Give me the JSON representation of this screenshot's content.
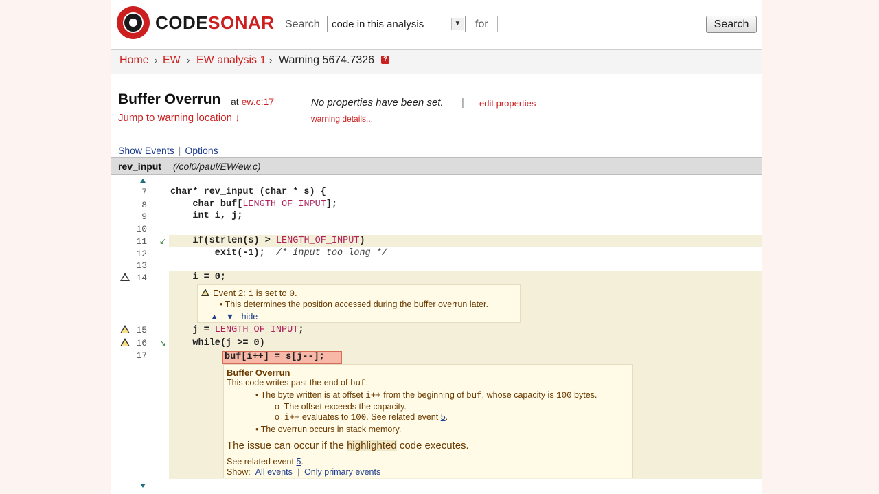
{
  "header": {
    "brand_part1": "CODE",
    "brand_part2": "SONAR",
    "search_label": "Search",
    "search_scope": "code in this analysis",
    "for_label": "for",
    "query_value": "",
    "search_button": "Search"
  },
  "breadcrumb": {
    "items": [
      "Home",
      "EW",
      "EW analysis 1",
      "Warning 5674.7326"
    ],
    "separator": "›",
    "help_icon": "?"
  },
  "warning": {
    "title": "Buffer Overrun",
    "at_label": "at",
    "location": "ew.c:17",
    "jump_link": "Jump to warning location ↓",
    "no_props": "No properties have been set.",
    "pipe": "|",
    "edit_props": "edit properties",
    "details": "warning details..."
  },
  "tabs": {
    "show_events": "Show Events",
    "options": "Options",
    "pipe": "|"
  },
  "file": {
    "function": "rev_input",
    "path": "(/col0/paul/EW/ew.c)"
  },
  "code": {
    "line_numbers": [
      "7",
      "8",
      "9",
      "10",
      "11",
      "12",
      "13",
      "14",
      "15",
      "16",
      "17"
    ],
    "lines": {
      "l7a": "char* rev_input (char * s) {",
      "l8a": "    char buf[",
      "l8m": "LENGTH_OF_INPUT",
      "l8b": "];",
      "l9a": "    int i, j;",
      "l11a": "    if(strlen(s) > ",
      "l11m": "LENGTH_OF_INPUT",
      "l11b": ")",
      "l12a": "        exit(-1);  ",
      "l12c": "/* input too long */",
      "l14a": "    i = 0;",
      "l15a": "    j = ",
      "l15m": "LENGTH_OF_INPUT",
      "l15b": ";",
      "l16a": "    while(j >= 0)",
      "l17a": "buf[i++] = s[j--];"
    }
  },
  "event2": {
    "label": "Event 2:",
    "var": "i",
    "text_after": "is set to",
    "value": "0",
    "period": ".",
    "bullet": "This determines the position accessed during the buffer overrun later.",
    "hide": "hide"
  },
  "overrun": {
    "title": "Buffer Overrun",
    "l1a": "This code writes past the end of ",
    "l1v": "buf",
    "l1b": ".",
    "l2a": "The byte written is at offset ",
    "l2v1": "i++",
    "l2b": " from the beginning of ",
    "l2v2": "buf",
    "l2c": ", whose capacity is ",
    "l2v3": "100",
    "l2d": " bytes.",
    "l3": "The offset exceeds the capacity.",
    "l4v1": "i++",
    "l4a": " evaluates to ",
    "l4v2": "100",
    "l4b": ".  See related event ",
    "l4link": "5",
    "l4c": ".",
    "l5": "The overrun occurs in stack memory.",
    "l6a": "The issue can occur if the ",
    "l6h": "highlighted",
    "l6b": " code executes.",
    "l7a": "See related event ",
    "l7link": "5",
    "l7b": ".",
    "l8a": "Show:",
    "l8all": "All events",
    "l8pipe": "|",
    "l8primary": "Only primary events"
  },
  "colors": {
    "brand_red": "#cc1f1f",
    "highlight": "#f3efd9",
    "link_blue": "#1f3f8f",
    "error_highlight": "#f8b8a8"
  }
}
